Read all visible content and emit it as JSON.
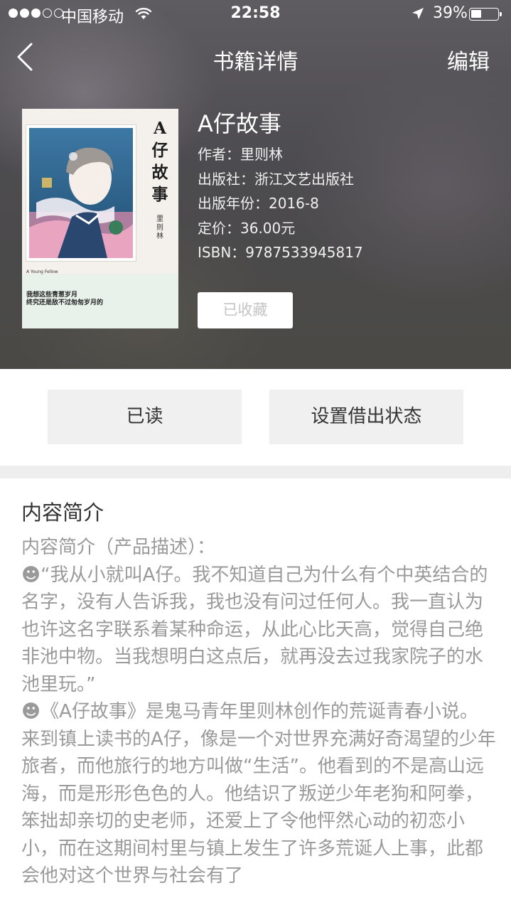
{
  "status_bar": {
    "carrier": "中国移动",
    "time": "22:58",
    "battery": "39%",
    "battery_level": 0.39
  },
  "nav": {
    "title": "书籍详情",
    "edit_label": "编辑"
  },
  "cover": {
    "title": "A仔故事",
    "author": "里则林",
    "english": "A Young Fellow",
    "tagline_1": "我想这些青葱岁月",
    "tagline_2": "终究还是敌不过匆匆岁月的"
  },
  "book": {
    "title": "A仔故事",
    "author": "作者：里则林",
    "publisher": "出版社：浙江文艺出版社",
    "year": "出版年份：2016-8",
    "price": "定价：36.00元",
    "isbn": "ISBN：9787533945817",
    "collect_label": "已收藏"
  },
  "actions": {
    "read_label": "已读",
    "lend_label": "设置借出状态"
  },
  "description": {
    "heading": "内容简介",
    "paragraphs": [
      "内容简介（产品描述）：",
      "☻“我从小就叫A仔。我不知道自己为什么有个中英结合的名字，没有人告诉我，我也没有问过任何人。我一直认为也许这名字联系着某种命运，从此心比天高，觉得自己绝非池中物。当我想明白这点后，就再没去过我家院子的水池里玩。”",
      "☻《A仔故事》是鬼马青年里则林创作的荒诞青春小说。",
      "来到镇上读书的A仔，像是一个对世界充满好奇渴望的少年旅者，而他旅行的地方叫做“生活”。他看到的不是高山远海，而是形形色色的人。他结识了叛逆少年老狗和阿拳，笨拙却亲切的史老师，还爱上了令他怦然心动的初恋小小，而在这期间村里与镇上发生了许多荒诞人上事，此都会他对这个世界与社会有了"
    ]
  }
}
